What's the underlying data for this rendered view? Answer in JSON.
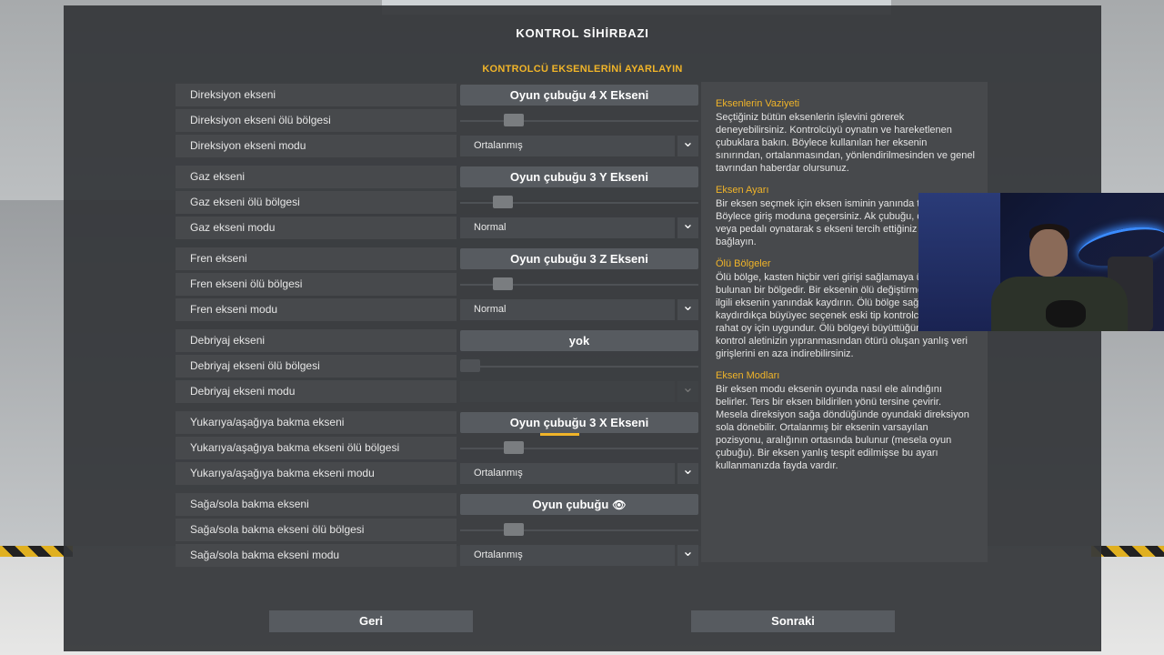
{
  "dialog": {
    "title": "KONTROL SİHİRBAZI",
    "subtitle": "KONTROLCÜ EKSENLERİNİ AYARLAYIN"
  },
  "rows": [
    {
      "label": "Direksiyon ekseni",
      "type": "button",
      "value": "Oyun çubuğu 4 X Ekseni"
    },
    {
      "label": "Direksiyon ekseni ölü bölgesi",
      "type": "slider",
      "level": 0.2
    },
    {
      "label": "Direksiyon ekseni modu",
      "type": "dropdown",
      "value": "Ortalanmış"
    },
    {
      "label": "Gaz ekseni",
      "type": "button",
      "value": "Oyun çubuğu 3 Y Ekseni"
    },
    {
      "label": "Gaz ekseni ölü bölgesi",
      "type": "slider",
      "level": 0.15
    },
    {
      "label": "Gaz ekseni modu",
      "type": "dropdown",
      "value": "Normal"
    },
    {
      "label": "Fren ekseni",
      "type": "button",
      "value": "Oyun çubuğu 3 Z Ekseni"
    },
    {
      "label": "Fren ekseni ölü bölgesi",
      "type": "slider",
      "level": 0.15
    },
    {
      "label": "Fren ekseni modu",
      "type": "dropdown",
      "value": "Normal"
    },
    {
      "label": "Debriyaj ekseni",
      "type": "button",
      "value": "yok"
    },
    {
      "label": "Debriyaj ekseni ölü bölgesi",
      "type": "slider",
      "level": 0.0,
      "disabled": true
    },
    {
      "label": "Debriyaj ekseni modu",
      "type": "dropdown",
      "value": "",
      "disabled": true
    },
    {
      "label": "Yukarıya/aşağıya bakma ekseni",
      "type": "button",
      "value": "Oyun çubuğu 3 X Ekseni",
      "highlight": true
    },
    {
      "label": "Yukarıya/aşağıya bakma ekseni ölü bölgesi",
      "type": "slider",
      "level": 0.2
    },
    {
      "label": "Yukarıya/aşağıya bakma ekseni modu",
      "type": "dropdown",
      "value": "Ortalanmış"
    },
    {
      "label": "Sağa/sola bakma ekseni",
      "type": "button",
      "value": "Oyun çubuğu",
      "eye": true
    },
    {
      "label": "Sağa/sola bakma ekseni ölü bölgesi",
      "type": "slider",
      "level": 0.2
    },
    {
      "label": "Sağa/sola bakma ekseni modu",
      "type": "dropdown",
      "value": "Ortalanmış"
    }
  ],
  "info": [
    {
      "title": "Eksenlerin Vaziyeti",
      "body": "Seçtiğiniz bütün eksenlerin işlevini görerek deneyebilirsiniz. Kontrolcüyü oynatın ve hareketlenen çubuklara bakın. Böylece kullanılan her eksenin sınırından, ortalanmasından, yönlendirilmesinden ve genel tavrından haberdar olursunuz."
    },
    {
      "title": "Eksen Ayarı",
      "body": "Bir eksen seçmek için eksen isminin yanında tıklayın. Böylece giriş moduna geçersiniz. Ak çubuğu, direksiyonu veya pedalı oynatarak s ekseni tercih ettiğiniz eksene bağlayın."
    },
    {
      "title": "Ölü Bölgeler",
      "body": "Ölü bölge, kasten hiçbir veri girişi sağlamaya üzerinde bulunan bir bölgedir. Bir eksenin ölü değiştirmek isterseniz ilgili eksenin yanındak kaydırın. Ölü bölge sağa kaydırdıkça büyüyec seçenek eski tip kontrolcülerle daha rahat oy için uygundur. Ölü bölgeyi büyüttüğünüzde kontrol aletinizin yıpranmasından ötürü oluşan yanlış veri girişlerini en aza indirebilirsiniz."
    },
    {
      "title": "Eksen Modları",
      "body": "Bir eksen modu eksenin oyunda nasıl ele alındığını belirler. Ters bir eksen bildirilen yönü tersine çevirir. Mesela direksiyon sağa döndüğünde oyundaki direksiyon sola dönebilir. Ortalanmış bir eksenin varsayılan pozisyonu, aralığının ortasında bulunur (mesela oyun çubuğu). Bir eksen yanlış tespit edilmişse bu ayarı kullanmanızda fayda vardır."
    }
  ],
  "buttons": {
    "back": "Geri",
    "next": "Sonraki"
  },
  "icons": {
    "dropdown_arrow": "chevron-down-icon",
    "eye": "eye-icon"
  },
  "colors": {
    "accent": "#f0b429",
    "panel": "#47494c",
    "button": "#575b60"
  }
}
